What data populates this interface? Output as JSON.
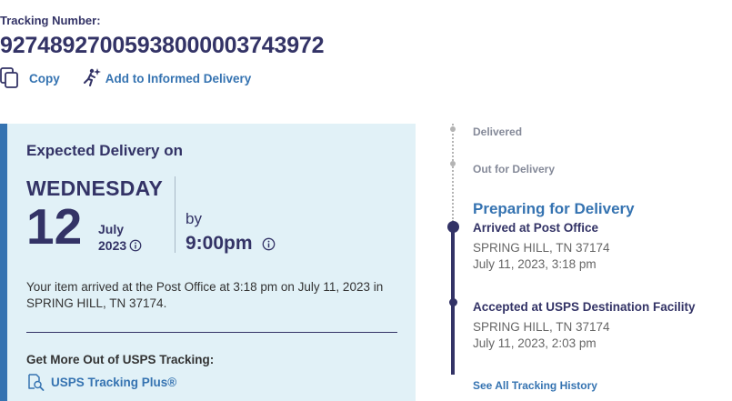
{
  "tracking": {
    "label": "Tracking Number:",
    "number": "9274892700593800000374 3972"
  },
  "actions": {
    "copy_label": "Copy",
    "informed_label": "Add to Informed Delivery"
  },
  "expected": {
    "label": "Expected Delivery on",
    "weekday": "WEDNESDAY",
    "day": "12",
    "month": "July",
    "year": "2023",
    "by_label": "by",
    "time": "9:00pm",
    "arrival_text": "Your item arrived at the Post Office at 3:18 pm on July 11, 2023 in SPRING HILL, TN 37174.",
    "more_label": "Get More Out of USPS Tracking:",
    "plus_label": "USPS Tracking Plus",
    "plus_mark": "®"
  },
  "timeline": {
    "steps": [
      {
        "label": "Delivered"
      },
      {
        "label": "Out for Delivery"
      }
    ],
    "current_status": "Preparing for Delivery",
    "events": [
      {
        "title": "Arrived at Post Office",
        "location": "SPRING HILL, TN 37174",
        "datetime": "July 11, 2023, 3:18 pm"
      },
      {
        "title": "Accepted at USPS Destination Facility",
        "location": "SPRING HILL, TN 37174",
        "datetime": "July 11, 2023, 2:03 pm"
      }
    ],
    "see_all_label": "See All Tracking History"
  },
  "colors": {
    "navy": "#333366",
    "link_blue": "#3573b1",
    "panel_bg": "#e1f1f7",
    "muted_grey": "#858a99"
  }
}
